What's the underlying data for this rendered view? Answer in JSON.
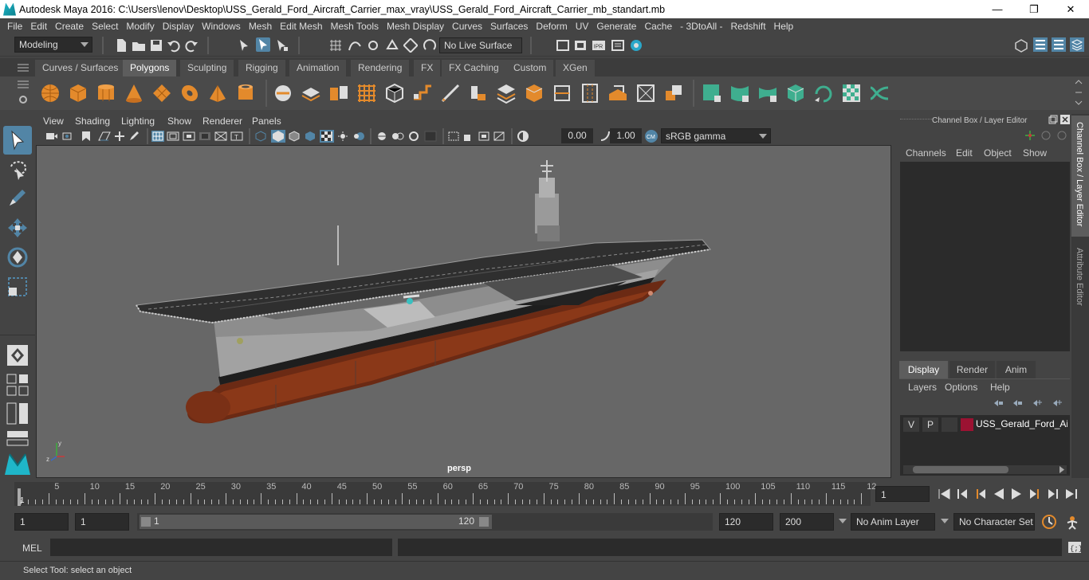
{
  "window": {
    "title": "Autodesk Maya 2016: C:\\Users\\lenov\\Desktop\\USS_Gerald_Ford_Aircraft_Carrier_max_vray\\USS_Gerald_Ford_Aircraft_Carrier_mb_standart.mb",
    "minimize": "—",
    "restore": "❐",
    "close": "✕"
  },
  "menubar": [
    "File",
    "Edit",
    "Create",
    "Select",
    "Modify",
    "Display",
    "Windows",
    "Mesh",
    "Edit Mesh",
    "Mesh Tools",
    "Mesh Display",
    "Curves",
    "Surfaces",
    "Deform",
    "UV",
    "Generate",
    "Cache",
    "- 3DtoAll -",
    "Redshift",
    "Help"
  ],
  "statusline": {
    "mode": "Modeling",
    "live_surface": "No Live Surface"
  },
  "shelf_tabs": [
    "Curves / Surfaces",
    "Polygons",
    "Sculpting",
    "Rigging",
    "Animation",
    "Rendering",
    "FX",
    "FX Caching",
    "Custom",
    "XGen"
  ],
  "shelf_active": "Polygons",
  "viewport": {
    "menu": [
      "View",
      "Shading",
      "Lighting",
      "Show",
      "Renderer",
      "Panels"
    ],
    "exposure": "0.00",
    "gamma": "1.00",
    "color_space": "sRGB gamma",
    "camera_label": "persp"
  },
  "channel_box": {
    "title": "Channel Box / Layer Editor",
    "menu": [
      "Channels",
      "Edit",
      "Object",
      "Show"
    ]
  },
  "layer_editor": {
    "tabs": [
      "Display",
      "Render",
      "Anim"
    ],
    "active_tab": "Display",
    "menu": [
      "Layers",
      "Options",
      "Help"
    ],
    "layer": {
      "v": "V",
      "p": "P",
      "name": "USS_Gerald_Ford_Aircr",
      "color": "#9b1232"
    }
  },
  "side_tabs": [
    "Channel Box / Layer Editor",
    "Attribute Editor"
  ],
  "timeline": {
    "ticks": [
      "5",
      "10",
      "15",
      "20",
      "25",
      "30",
      "35",
      "40",
      "45",
      "50",
      "55",
      "60",
      "65",
      "70",
      "75",
      "80",
      "85",
      "90",
      "95",
      "100",
      "105",
      "110",
      "115",
      "12"
    ],
    "current_marker": "1",
    "current_frame": "1"
  },
  "range": {
    "start": "1",
    "playback_start": "1",
    "slider_start": "1",
    "slider_end": "120",
    "playback_end": "120",
    "end": "200",
    "anim_layer": "No Anim Layer",
    "character_set": "No Character Set"
  },
  "command_line": {
    "label": "MEL"
  },
  "help_line": "Select Tool: select an object",
  "colors": {
    "accent": "#5285a6",
    "shelf_orange": "#e38a2c",
    "shelf_green": "#3fae8f",
    "hull_red": "#7a2e14"
  }
}
